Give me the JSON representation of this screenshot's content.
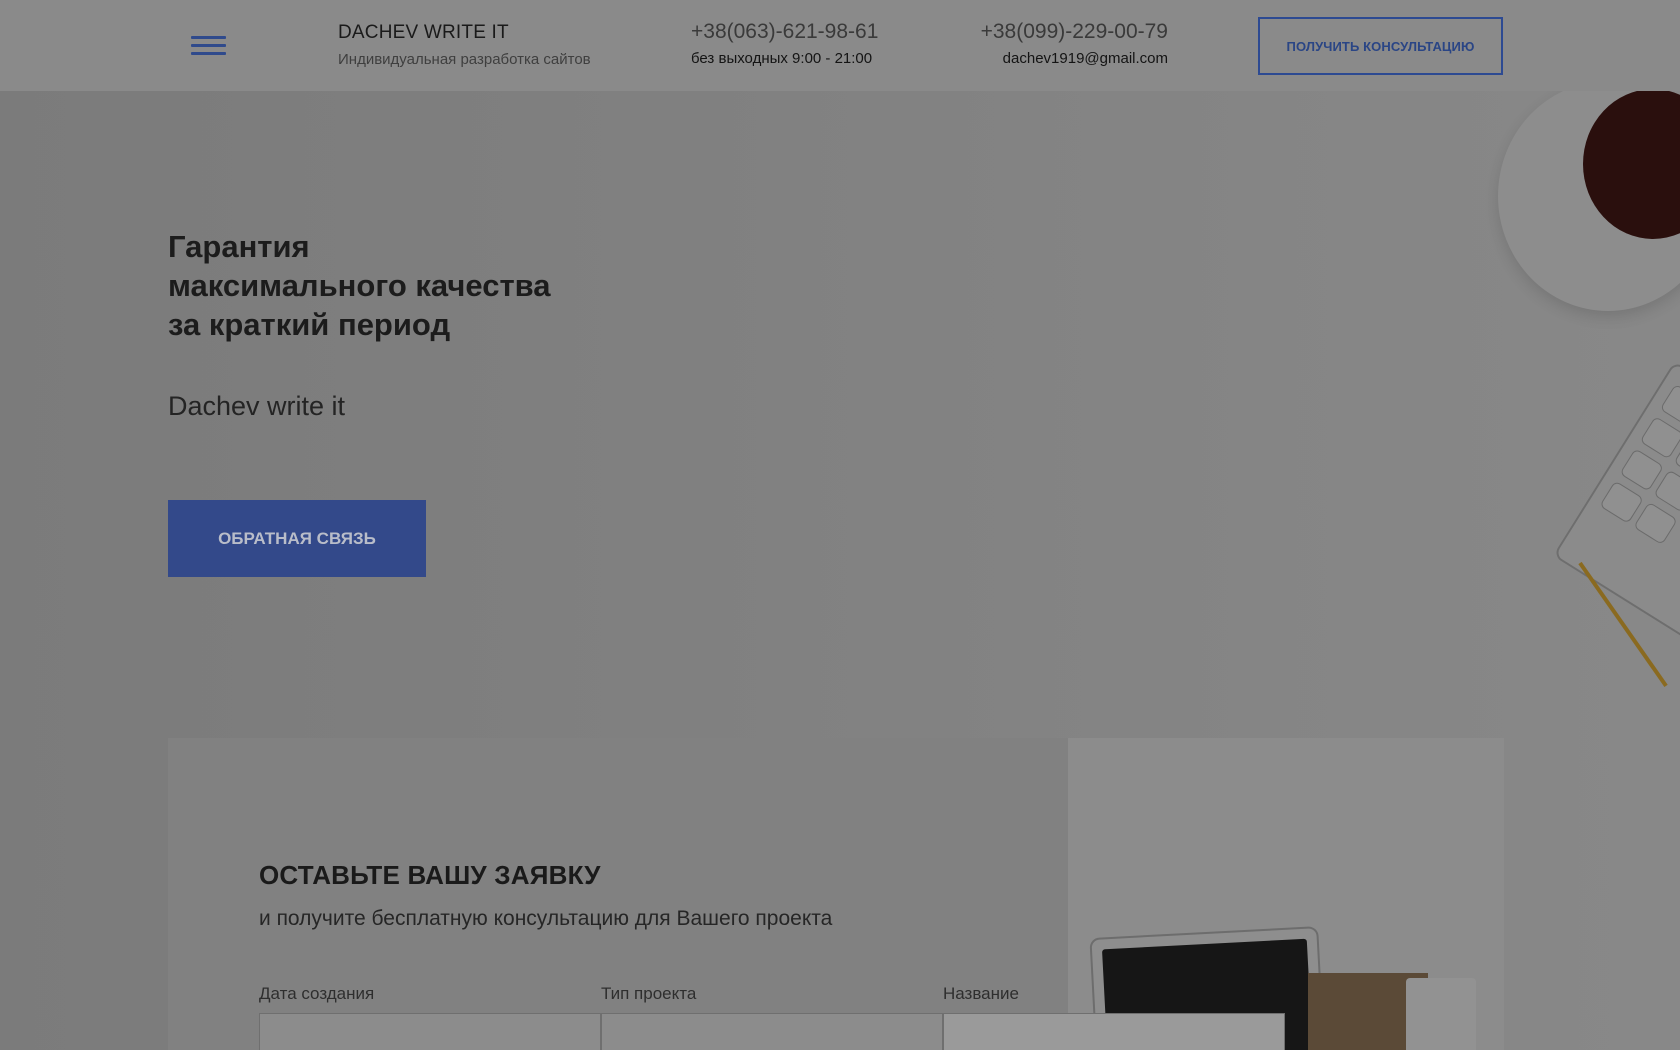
{
  "header": {
    "brand_title": "DACHEV WRITE IT",
    "brand_subtitle": "Индивидуальная разработка сайтов",
    "phone_1": "+38(063)-621-98-61",
    "hours": "без выходных 9:00 - 21:00",
    "phone_2": "+38(099)-229-00-79",
    "email": "dachev1919@gmail.com",
    "consult_button": "ПОЛУЧИТЬ КОНСУЛЬТАЦИЮ"
  },
  "hero": {
    "heading_line_1": "Гарантия",
    "heading_line_2": "максимального качества",
    "heading_line_3": "за краткий период",
    "subtitle": "Dachev write it",
    "feedback_button": "ОБРАТНАЯ СВЯЗЬ"
  },
  "request": {
    "title": "ОСТАВЬТЕ ВАШУ ЗАЯВКУ",
    "subtitle": "и получите бесплатную консультацию для Вашего проекта",
    "fields": [
      {
        "label": "Дата создания"
      },
      {
        "label": "Тип проекта"
      },
      {
        "label": "Название"
      }
    ]
  },
  "colors": {
    "accent": "#2d4a92",
    "overlay": "#7f7f7f"
  }
}
